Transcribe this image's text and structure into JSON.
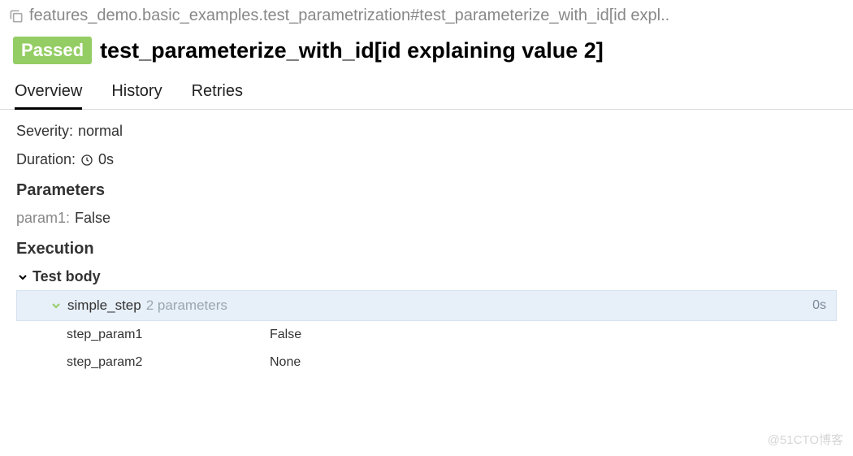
{
  "breadcrumb": "features_demo.basic_examples.test_parametrization#test_parameterize_with_id[id expl..",
  "status": {
    "label": "Passed",
    "color": "#94cd64"
  },
  "title": "test_parameterize_with_id[id explaining value 2]",
  "tabs": [
    {
      "label": "Overview",
      "active": true
    },
    {
      "label": "History",
      "active": false
    },
    {
      "label": "Retries",
      "active": false
    }
  ],
  "severity": {
    "label": "Severity:",
    "value": "normal"
  },
  "duration": {
    "label": "Duration:",
    "value": "0s"
  },
  "parameters_heading": "Parameters",
  "parameters": [
    {
      "name": "param1",
      "value": "False"
    }
  ],
  "execution_heading": "Execution",
  "test_body_heading": "Test body",
  "steps": [
    {
      "name": "simple_step",
      "sub": "2 parameters",
      "duration": "0s",
      "params": [
        {
          "name": "step_param1",
          "value": "False"
        },
        {
          "name": "step_param2",
          "value": "None"
        }
      ]
    }
  ],
  "watermark": "@51CTO博客"
}
